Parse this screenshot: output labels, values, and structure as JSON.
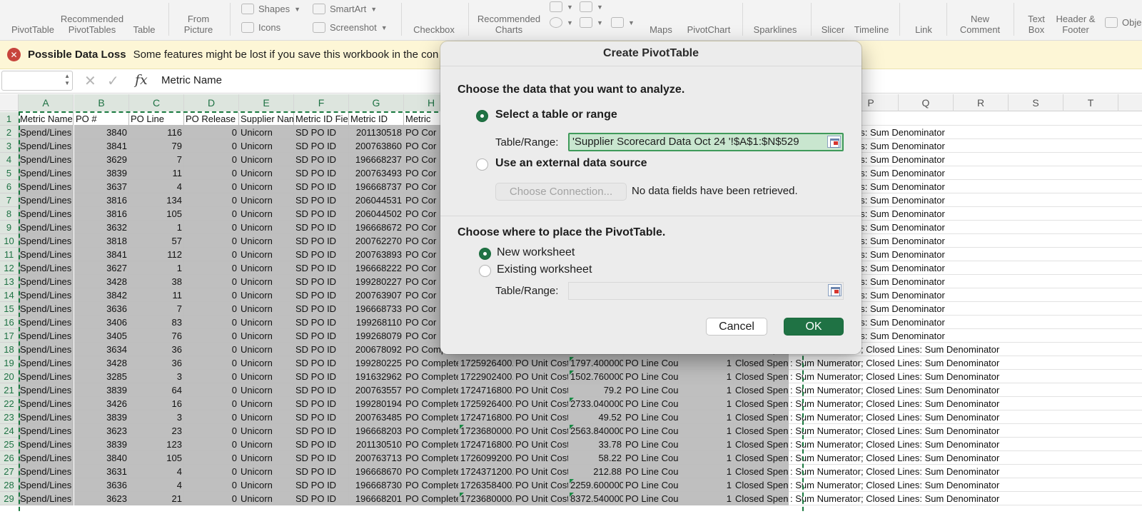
{
  "ribbon": {
    "buttons": [
      {
        "id": "pivottable",
        "label": "PivotTable"
      },
      {
        "id": "recommended-pivottables",
        "label": "Recommended\nPivotTables"
      },
      {
        "id": "table",
        "label": "Table"
      },
      {
        "id": "from-picture",
        "label": "From\nPicture"
      },
      {
        "id": "checkbox",
        "label": "Checkbox"
      },
      {
        "id": "recommended-charts",
        "label": "Recommended\nCharts"
      },
      {
        "id": "maps",
        "label": "Maps"
      },
      {
        "id": "pivotchart",
        "label": "PivotChart"
      },
      {
        "id": "sparklines",
        "label": "Sparklines"
      },
      {
        "id": "slicer",
        "label": "Slicer"
      },
      {
        "id": "timeline",
        "label": "Timeline"
      },
      {
        "id": "link",
        "label": "Link"
      },
      {
        "id": "new-comment",
        "label": "New\nComment"
      },
      {
        "id": "text-box",
        "label": "Text\nBox"
      },
      {
        "id": "header-footer",
        "label": "Header &\nFooter"
      },
      {
        "id": "object",
        "label": "Obje"
      }
    ],
    "shapes": "Shapes",
    "icons": "Icons",
    "smartart": "SmartArt",
    "screenshot": "Screenshot"
  },
  "message_bar": {
    "title": "Possible Data Loss",
    "text": "Some features might be lost if you save this workbook in the con"
  },
  "formula_bar": {
    "name_box": "",
    "fx": "fx",
    "content": "Metric Name"
  },
  "columns": [
    "A",
    "B",
    "C",
    "D",
    "E",
    "F",
    "G",
    "H",
    "I",
    "J",
    "K",
    "L",
    "M",
    "N",
    "O",
    "P",
    "Q",
    "R",
    "S",
    "T"
  ],
  "header_row": [
    "Metric Name",
    "PO #",
    "PO Line",
    "PO Release",
    "Supplier Nam",
    "Metric ID Fie",
    "Metric ID",
    "Metric"
  ],
  "rows": [
    {
      "n": "2",
      "a": "Spend/Lines",
      "b": "3840",
      "c": "116",
      "d": "0",
      "e": "Unicorn",
      "f": "SD PO ID",
      "g": "201130518",
      "h": "PO Cor",
      "i": "",
      "j": "",
      "k": "",
      "l": "",
      "m": "",
      "n2": "",
      "o": "ator; Closed Lines: Sum Denominator"
    },
    {
      "n": "3",
      "a": "Spend/Lines",
      "b": "3841",
      "c": "79",
      "d": "0",
      "e": "Unicorn",
      "f": "SD PO ID",
      "g": "200763860",
      "h": "PO Cor",
      "o": "ator; Closed Lines: Sum Denominator"
    },
    {
      "n": "4",
      "a": "Spend/Lines",
      "b": "3629",
      "c": "7",
      "d": "0",
      "e": "Unicorn",
      "f": "SD PO ID",
      "g": "196668237",
      "h": "PO Cor",
      "o": "ator; Closed Lines: Sum Denominator"
    },
    {
      "n": "5",
      "a": "Spend/Lines",
      "b": "3839",
      "c": "11",
      "d": "0",
      "e": "Unicorn",
      "f": "SD PO ID",
      "g": "200763493",
      "h": "PO Cor",
      "o": "ator; Closed Lines: Sum Denominator"
    },
    {
      "n": "6",
      "a": "Spend/Lines",
      "b": "3637",
      "c": "4",
      "d": "0",
      "e": "Unicorn",
      "f": "SD PO ID",
      "g": "196668737",
      "h": "PO Cor",
      "o": "ator; Closed Lines: Sum Denominator"
    },
    {
      "n": "7",
      "a": "Spend/Lines",
      "b": "3816",
      "c": "134",
      "d": "0",
      "e": "Unicorn",
      "f": "SD PO ID",
      "g": "206044531",
      "h": "PO Cor",
      "o": "ator; Closed Lines: Sum Denominator"
    },
    {
      "n": "8",
      "a": "Spend/Lines",
      "b": "3816",
      "c": "105",
      "d": "0",
      "e": "Unicorn",
      "f": "SD PO ID",
      "g": "206044502",
      "h": "PO Cor",
      "o": "ator; Closed Lines: Sum Denominator"
    },
    {
      "n": "9",
      "a": "Spend/Lines",
      "b": "3632",
      "c": "1",
      "d": "0",
      "e": "Unicorn",
      "f": "SD PO ID",
      "g": "196668672",
      "h": "PO Cor",
      "o": "ator; Closed Lines: Sum Denominator"
    },
    {
      "n": "10",
      "a": "Spend/Lines",
      "b": "3818",
      "c": "57",
      "d": "0",
      "e": "Unicorn",
      "f": "SD PO ID",
      "g": "200762270",
      "h": "PO Cor",
      "o": "ator; Closed Lines: Sum Denominator"
    },
    {
      "n": "11",
      "a": "Spend/Lines",
      "b": "3841",
      "c": "112",
      "d": "0",
      "e": "Unicorn",
      "f": "SD PO ID",
      "g": "200763893",
      "h": "PO Cor",
      "o": "ator; Closed Lines: Sum Denominator"
    },
    {
      "n": "12",
      "a": "Spend/Lines",
      "b": "3627",
      "c": "1",
      "d": "0",
      "e": "Unicorn",
      "f": "SD PO ID",
      "g": "196668222",
      "h": "PO Cor",
      "o": "ator; Closed Lines: Sum Denominator"
    },
    {
      "n": "13",
      "a": "Spend/Lines",
      "b": "3428",
      "c": "38",
      "d": "0",
      "e": "Unicorn",
      "f": "SD PO ID",
      "g": "199280227",
      "h": "PO Cor",
      "o": "ator; Closed Lines: Sum Denominator"
    },
    {
      "n": "14",
      "a": "Spend/Lines",
      "b": "3842",
      "c": "11",
      "d": "0",
      "e": "Unicorn",
      "f": "SD PO ID",
      "g": "200763907",
      "h": "PO Cor",
      "o": "ator; Closed Lines: Sum Denominator"
    },
    {
      "n": "15",
      "a": "Spend/Lines",
      "b": "3636",
      "c": "7",
      "d": "0",
      "e": "Unicorn",
      "f": "SD PO ID",
      "g": "196668733",
      "h": "PO Cor",
      "o": "ator; Closed Lines: Sum Denominator"
    },
    {
      "n": "16",
      "a": "Spend/Lines",
      "b": "3406",
      "c": "83",
      "d": "0",
      "e": "Unicorn",
      "f": "SD PO ID",
      "g": "199268110",
      "h": "PO Cor",
      "o": "ator; Closed Lines: Sum Denominator"
    },
    {
      "n": "17",
      "a": "Spend/Lines",
      "b": "3405",
      "c": "76",
      "d": "0",
      "e": "Unicorn",
      "f": "SD PO ID",
      "g": "199268079",
      "h": "PO Cor",
      "o": "ator; Closed Lines: Sum Denominator"
    },
    {
      "n": "18",
      "a": "Spend/Lines",
      "b": "3634",
      "c": "36",
      "d": "0",
      "e": "Unicorn",
      "f": "SD PO ID",
      "g": "200678092",
      "h": "PO Complete",
      "i": "1723507200.",
      "j": "PO Unit Cost",
      "k": "91",
      "l": "PO Line Cour",
      "m": "1",
      "n2": "Closed Spend",
      "o": ": Sum Numerator; Closed Lines: Sum Denominator"
    },
    {
      "n": "19",
      "a": "Spend/Lines",
      "b": "3428",
      "c": "36",
      "d": "0",
      "e": "Unicorn",
      "f": "SD PO ID",
      "g": "199280225",
      "h": "PO Complete",
      "i": "1725926400.",
      "j": "PO Unit Cost",
      "k": "1797.400000",
      "l": "PO Line Cour",
      "m": "1",
      "n2": "Closed Spend",
      "o": ": Sum Numerator; Closed Lines: Sum Denominator"
    },
    {
      "n": "20",
      "a": "Spend/Lines",
      "b": "3285",
      "c": "3",
      "d": "0",
      "e": "Unicorn",
      "f": "SD PO ID",
      "g": "191632962",
      "h": "PO Complete",
      "i": "1722902400.",
      "j": "PO Unit Cost",
      "k": "1502.760000",
      "l": "PO Line Cour",
      "m": "1",
      "n2": "Closed Spend",
      "o": ": Sum Numerator; Closed Lines: Sum Denominator"
    },
    {
      "n": "21",
      "a": "Spend/Lines",
      "b": "3839",
      "c": "64",
      "d": "0",
      "e": "Unicorn",
      "f": "SD PO ID",
      "g": "200763557",
      "h": "PO Complete",
      "i": "1724716800.",
      "j": "PO Unit Cost",
      "k": "79.2",
      "l": "PO Line Cour",
      "m": "1",
      "n2": "Closed Spend",
      "o": ": Sum Numerator; Closed Lines: Sum Denominator"
    },
    {
      "n": "22",
      "a": "Spend/Lines",
      "b": "3426",
      "c": "16",
      "d": "0",
      "e": "Unicorn",
      "f": "SD PO ID",
      "g": "199280194",
      "h": "PO Complete",
      "i": "1725926400.",
      "j": "PO Unit Cost",
      "k": "2733.040000",
      "l": "PO Line Cour",
      "m": "1",
      "n2": "Closed Spend",
      "o": ": Sum Numerator; Closed Lines: Sum Denominator"
    },
    {
      "n": "23",
      "a": "Spend/Lines",
      "b": "3839",
      "c": "3",
      "d": "0",
      "e": "Unicorn",
      "f": "SD PO ID",
      "g": "200763485",
      "h": "PO Complete",
      "i": "1724716800.",
      "j": "PO Unit Cost",
      "k": "49.52",
      "l": "PO Line Cour",
      "m": "1",
      "n2": "Closed Spend",
      "o": ": Sum Numerator; Closed Lines: Sum Denominator"
    },
    {
      "n": "24",
      "a": "Spend/Lines",
      "b": "3623",
      "c": "23",
      "d": "0",
      "e": "Unicorn",
      "f": "SD PO ID",
      "g": "196668203",
      "h": "PO Complete",
      "i": "1723680000.",
      "j": "PO Unit Cost",
      "k": "2563.840000",
      "l": "PO Line Cour",
      "m": "1",
      "n2": "Closed Spend",
      "o": ": Sum Numerator; Closed Lines: Sum Denominator"
    },
    {
      "n": "25",
      "a": "Spend/Lines",
      "b": "3839",
      "c": "123",
      "d": "0",
      "e": "Unicorn",
      "f": "SD PO ID",
      "g": "201130510",
      "h": "PO Complete",
      "i": "1724716800.",
      "j": "PO Unit Cost",
      "k": "33.78",
      "l": "PO Line Cour",
      "m": "1",
      "n2": "Closed Spend",
      "o": ": Sum Numerator; Closed Lines: Sum Denominator"
    },
    {
      "n": "26",
      "a": "Spend/Lines",
      "b": "3840",
      "c": "105",
      "d": "0",
      "e": "Unicorn",
      "f": "SD PO ID",
      "g": "200763713",
      "h": "PO Complete",
      "i": "1726099200.",
      "j": "PO Unit Cost",
      "k": "58.22",
      "l": "PO Line Cour",
      "m": "1",
      "n2": "Closed Spend",
      "o": ": Sum Numerator; Closed Lines: Sum Denominator"
    },
    {
      "n": "27",
      "a": "Spend/Lines",
      "b": "3631",
      "c": "4",
      "d": "0",
      "e": "Unicorn",
      "f": "SD PO ID",
      "g": "196668670",
      "h": "PO Complete",
      "i": "1724371200.",
      "j": "PO Unit Cost",
      "k": "212.88",
      "l": "PO Line Cour",
      "m": "1",
      "n2": "Closed Spend",
      "o": ": Sum Numerator; Closed Lines: Sum Denominator"
    },
    {
      "n": "28",
      "a": "Spend/Lines",
      "b": "3636",
      "c": "4",
      "d": "0",
      "e": "Unicorn",
      "f": "SD PO ID",
      "g": "196668730",
      "h": "PO Complete",
      "i": "1726358400.",
      "j": "PO Unit Cost",
      "k": "2259.600000",
      "l": "PO Line Cour",
      "m": "1",
      "n2": "Closed Spend",
      "o": ": Sum Numerator; Closed Lines: Sum Denominator"
    },
    {
      "n": "29",
      "a": "Spend/Lines",
      "b": "3623",
      "c": "21",
      "d": "0",
      "e": "Unicorn",
      "f": "SD PO ID",
      "g": "196668201",
      "h": "PO Complete",
      "i": "1723680000.",
      "j": "PO Unit Cost",
      "k": "8372.540000",
      "l": "PO Line Cour",
      "m": "1",
      "n2": "Closed Spend",
      "o": ": Sum Numerator; Closed Lines: Sum Denominator"
    }
  ],
  "dialog": {
    "title": "Create PivotTable",
    "section1": "Choose the data that you want to analyze.",
    "opt_table": "Select a table or range",
    "table_range_label": "Table/Range:",
    "table_range_value": "'Supplier Scorecard Data Oct 24 '!$A$1:$N$529",
    "opt_external": "Use an external data source",
    "choose_connection": "Choose Connection...",
    "no_data": "No data fields have been retrieved.",
    "section2": "Choose where to place the PivotTable.",
    "opt_new": "New worksheet",
    "opt_existing": "Existing worksheet",
    "table_range_label2": "Table/Range:",
    "table_range_value2": "",
    "cancel": "Cancel",
    "ok": "OK"
  },
  "colors": {
    "accent": "#1f7244",
    "selection": "#bfbfbf",
    "message_bar": "#fdf6d6",
    "error_icon": "#c7443c"
  }
}
